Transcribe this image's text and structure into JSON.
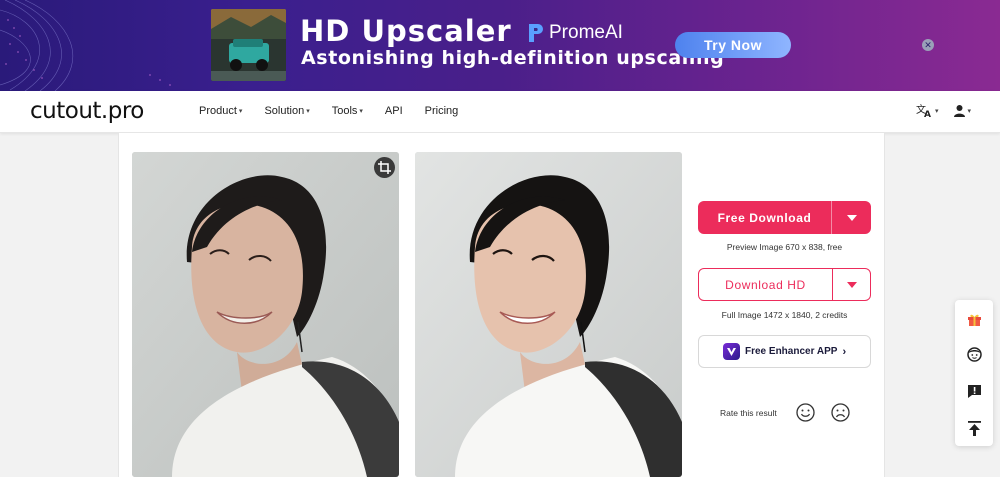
{
  "banner": {
    "title": "HD Upscaler",
    "subtitle": "Astonishing high-definition upscaling",
    "brand": "PromeAI",
    "cta": "Try Now",
    "close_icon": "close-icon"
  },
  "nav": {
    "logo": "cutout.pro",
    "items": [
      {
        "label": "Product",
        "has_caret": true
      },
      {
        "label": "Solution",
        "has_caret": true
      },
      {
        "label": "Tools",
        "has_caret": true
      },
      {
        "label": "API",
        "has_caret": false
      },
      {
        "label": "Pricing",
        "has_caret": false
      }
    ],
    "language_icon": "translate-icon",
    "user_icon": "user-icon"
  },
  "panel": {
    "free_download_label": "Free Download",
    "free_caption": "Preview Image 670 x 838, free",
    "hd_download_label": "Download HD",
    "hd_caption": "Full Image 1472 x 1840, 2 credits",
    "app_label": "Free Enhancer APP",
    "rate_label": "Rate this result"
  },
  "colors": {
    "accent": "#ec2c5b",
    "banner_start": "#2a1a7a",
    "banner_end": "#8a2a92"
  },
  "sidebar": {
    "icons": [
      "gift-icon",
      "avatar-face-icon",
      "feedback-icon",
      "back-to-top-icon"
    ]
  }
}
